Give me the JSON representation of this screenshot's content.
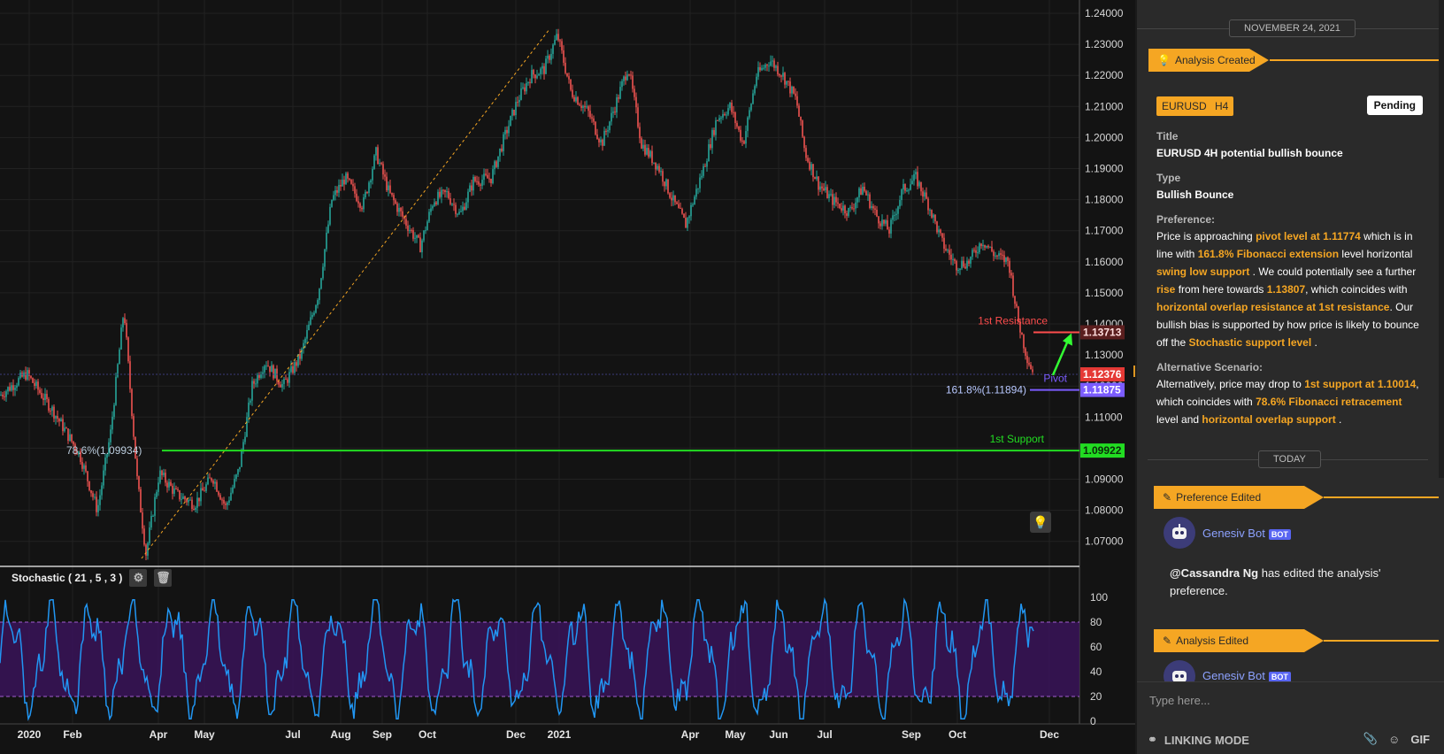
{
  "chart": {
    "price_ticks": [
      "1.24000",
      "1.23000",
      "1.22000",
      "1.21000",
      "1.20000",
      "1.19000",
      "1.18000",
      "1.17000",
      "1.16000",
      "1.15000",
      "1.14000",
      "1.13000",
      "1.12000",
      "1.11000",
      "1.10000",
      "1.09000",
      "1.08000",
      "1.07000"
    ],
    "date_ticks": [
      "2020",
      "Feb",
      "Apr",
      "May",
      "Jul",
      "Aug",
      "Sep",
      "Oct",
      "Dec",
      "2021",
      "Apr",
      "May",
      "Jun",
      "Jul",
      "Sep",
      "Oct",
      "Dec"
    ],
    "stoch_ticks": [
      "100",
      "80",
      "60",
      "40",
      "20",
      "0"
    ],
    "stoch_title": "Stochastic ( 21 , 5 , 3 )",
    "labels": {
      "resistance": "1st Resistance",
      "resistance_price": "1.13713",
      "pivot": "Pivot",
      "current_price": "1.12376",
      "fib_ext": "161.8%(1.11894)",
      "fib_ext_price": "1.11875",
      "fib_ret": "78.6%(1.09934)",
      "support": "1st Support",
      "support_price": "1.09922"
    },
    "colors": {
      "up": "#26a69a",
      "down": "#ef5350",
      "resistance": "#ff4d4d",
      "pivot": "#7b5cff",
      "support": "#22dd22",
      "stoch_line": "#2196f3",
      "stoch_band": "#3a1459"
    }
  },
  "panel": {
    "date_sep": "NOVEMBER 24, 2021",
    "analysis_created": "Analysis Created",
    "tags": [
      "EURUSD",
      "H4"
    ],
    "status": "Pending",
    "title_label": "Title",
    "title_value": "EURUSD 4H potential bullish bounce",
    "type_label": "Type",
    "type_value": "Bullish Bounce",
    "pref_label": "Preference:",
    "pref_parts": [
      "Price is approaching ",
      "pivot level at 1.11774",
      " which is in line with ",
      "161.8% Fibonacci extension",
      " level horizontal ",
      "swing low support",
      " . We could potentially see a further ",
      "rise",
      " from here towards ",
      "1.13807",
      ", which coincides with ",
      "horizontal overlap resistance at 1st resistance",
      ".  Our bullish bias is supported by how price is likely to bounce off the ",
      "Stochastic support level",
      " ."
    ],
    "alt_label": "Alternative Scenario:",
    "alt_parts": [
      "Alternatively, price may drop to ",
      "1st support at 1.10014",
      ", which coincides with ",
      "78.6% Fibonacci retracement",
      " level and ",
      "horizontal overlap support",
      " ."
    ],
    "today_sep": "TODAY",
    "pref_edited": "Preference Edited",
    "bot_name": "Genesiv Bot",
    "bot_badge": "BOT",
    "edit_msg_user": "@Cassandra Ng",
    "edit_msg_text": " has edited the analysis' preference.",
    "analysis_edited": "Analysis Edited",
    "input_placeholder": "Type here...",
    "linking_mode": "LINKING MODE",
    "gif": "GIF"
  }
}
